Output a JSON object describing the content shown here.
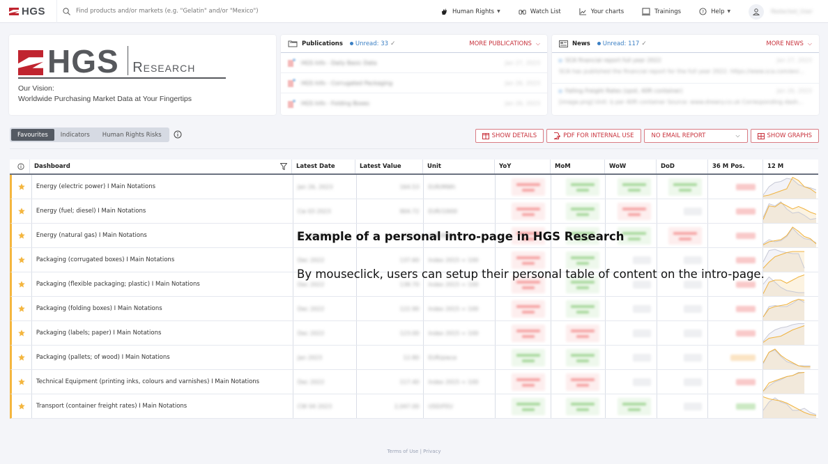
{
  "topbar": {
    "brand": "HGS",
    "search_placeholder": "Find products and/or markets (e.g. \"Gelatin\" and/or \"Mexico\")",
    "nav": [
      {
        "label": "Human Rights",
        "icon": "hand-icon",
        "dropdown": true
      },
      {
        "label": "Watch List",
        "icon": "binoculars-icon",
        "dropdown": false
      },
      {
        "label": "Your charts",
        "icon": "chart-icon",
        "dropdown": false
      },
      {
        "label": "Trainings",
        "icon": "monitor-icon",
        "dropdown": false
      },
      {
        "label": "Help",
        "icon": "help-icon",
        "dropdown": true
      }
    ],
    "user_name": "Redacted_User"
  },
  "logo_card": {
    "brand": "HGS",
    "research": "Research",
    "vision_line1": "Our Vision:",
    "vision_line2": "Worldwide Purchasing Market Data at Your Fingertips"
  },
  "publications": {
    "title": "Publications",
    "unread": "Unread: 33",
    "more": "MORE PUBLICATIONS",
    "items": [
      {
        "title": "HGS Info - Daily Basic Data",
        "date": "Jan 27, 2023"
      },
      {
        "title": "HGS Info - Corrugated Packaging",
        "date": "Jan 26, 2023"
      },
      {
        "title": "HGS Info - Folding Boxes",
        "date": "Jan 26, 2023"
      }
    ]
  },
  "news": {
    "title": "News",
    "unread": "Unread: 117",
    "more": "MORE NEWS",
    "items": [
      {
        "title": "SCA financial report full year 2022",
        "date": "Jan 27, 2023",
        "body": "SCA has published the financial report for the full year 2022. https://www.sca.com/en/..."
      },
      {
        "title": "Falling Freight Rates (spot, 40ft container)",
        "date": "Jan 26, 2023",
        "body": "[image.png] Unit: $ per 40ft container Source: www.drewry.co.uk Corresponding dash..."
      }
    ]
  },
  "tabs": [
    {
      "label": "Favourites",
      "active": true
    },
    {
      "label": "Indicators",
      "active": false
    },
    {
      "label": "Human Rights Risks",
      "active": false
    }
  ],
  "actions": {
    "show_details": "SHOW DETAILS",
    "pdf": "PDF FOR INTERNAL USE",
    "email_select": "NO EMAIL REPORT",
    "show_graphs": "SHOW GRAPHS"
  },
  "table": {
    "columns": [
      "Dashboard",
      "Latest Date",
      "Latest Value",
      "Unit",
      "YoY",
      "MoM",
      "WoW",
      "DoD",
      "36 M Pos.",
      "12 M"
    ],
    "rows": [
      {
        "name": "Energy (electric power) I Main Notations",
        "date": "Jan 26, 2023",
        "value": "164.53",
        "unit": "EUR/MWh",
        "yoy": "red",
        "mom": "green",
        "wow": "green",
        "dod": "green",
        "pos": "red"
      },
      {
        "name": "Energy (fuel; diesel) I Main Notations",
        "date": "Cw 03 2023",
        "value": "904.72",
        "unit": "EUR/1000l",
        "yoy": "red",
        "mom": "green",
        "wow": "red",
        "dod": "gray",
        "pos": "red"
      },
      {
        "name": "Energy (natural gas) I Main Notations",
        "date": "Jan 26, 2023",
        "value": "55.10",
        "unit": "EUR/MWh",
        "yoy": "red",
        "mom": "green",
        "wow": "green",
        "dod": "red",
        "pos": "red"
      },
      {
        "name": "Packaging (corrugated boxes) I Main Notations",
        "date": "Dec 2022",
        "value": "137.60",
        "unit": "Index 2015 = 100",
        "yoy": "red",
        "mom": "green",
        "wow": "gray",
        "dod": "gray",
        "pos": "red"
      },
      {
        "name": "Packaging (flexible packaging; plastic) I Main Notations",
        "date": "Dec 2022",
        "value": "138.70",
        "unit": "Index 2015 = 100",
        "yoy": "red",
        "mom": "green",
        "wow": "gray",
        "dod": "gray",
        "pos": "red"
      },
      {
        "name": "Packaging (folding boxes) I Main Notations",
        "date": "Dec 2022",
        "value": "122.90",
        "unit": "Index 2015 = 100",
        "yoy": "red",
        "mom": "green",
        "wow": "gray",
        "dod": "gray",
        "pos": "red"
      },
      {
        "name": "Packaging (labels; paper) I Main Notations",
        "date": "Dec 2022",
        "value": "123.00",
        "unit": "Index 2015 = 100",
        "yoy": "red",
        "mom": "red",
        "wow": "gray",
        "dod": "gray",
        "pos": "red"
      },
      {
        "name": "Packaging (pallets; of wood) I Main Notations",
        "date": "Jan 2023",
        "value": "12.80",
        "unit": "EUR/piece",
        "yoy": "green",
        "mom": "green",
        "wow": "gray",
        "dod": "gray",
        "pos": "orange"
      },
      {
        "name": "Technical Equipment (printing inks, colours and varnishes) I Main Notations",
        "date": "Dec 2022",
        "value": "117.40",
        "unit": "Index 2015 = 100",
        "yoy": "red",
        "mom": "red",
        "wow": "gray",
        "dod": "gray",
        "pos": "red"
      },
      {
        "name": "Transport (container freight rates) I Main Notations",
        "date": "CW 04 2023",
        "value": "2,047.00",
        "unit": "USD/FEU",
        "yoy": "green",
        "mom": "green",
        "wow": "green",
        "dod": "gray",
        "pos": "green"
      }
    ],
    "sparklines": [
      {
        "current": [
          0.05,
          0.1,
          0.2,
          0.3,
          0.4,
          0.95,
          0.8,
          0.5,
          0.4,
          0.2
        ],
        "previous": [
          0.1,
          0.5,
          0.7,
          0.75,
          0.9,
          0.85,
          0.6,
          0.5,
          0.45,
          0.35
        ]
      },
      {
        "current": [
          0.1,
          0.75,
          0.7,
          0.9,
          0.75,
          0.6,
          0.72,
          0.6,
          0.45,
          0.35
        ],
        "previous": [
          0.2,
          0.85,
          0.75,
          0.95,
          0.6,
          0.4,
          0.45,
          0.3,
          0.1,
          0.15
        ]
      },
      {
        "current": [
          0.05,
          0.2,
          0.25,
          0.3,
          0.5,
          0.9,
          0.7,
          0.45,
          0.35,
          0.1
        ],
        "previous": [
          0.1,
          0.3,
          0.2,
          0.25,
          0.45,
          0.85,
          0.55,
          0.35,
          0.3,
          0.15
        ]
      },
      {
        "current": [
          0.1,
          0.4,
          0.65,
          0.75,
          0.85,
          0.9,
          0.9,
          0.9,
          null,
          null
        ],
        "previous": [
          0.4,
          0.95,
          1.0,
          0.9,
          0.85,
          0.8,
          0.8,
          0.1,
          null,
          null
        ]
      },
      {
        "current": [
          0.05,
          0.6,
          0.7,
          0.7,
          0.55,
          0.7,
          0.85,
          0.95,
          null,
          null
        ],
        "previous": [
          0.5,
          0.85,
          0.6,
          0.35,
          0.2,
          0.15,
          0.1,
          0.1,
          null,
          null
        ]
      },
      {
        "current": [
          0.1,
          0.5,
          0.6,
          0.65,
          0.7,
          0.85,
          0.95,
          0.9,
          null,
          null
        ],
        "previous": [
          0.1,
          0.6,
          0.65,
          0.6,
          0.6,
          0.75,
          0.95,
          0.8,
          null,
          null
        ]
      },
      {
        "current": [
          0.05,
          0.25,
          0.3,
          0.35,
          0.5,
          0.65,
          0.75,
          0.85,
          null,
          null
        ],
        "previous": [
          0.1,
          0.45,
          0.65,
          0.75,
          0.8,
          0.9,
          0.95,
          0.95,
          null,
          null
        ]
      },
      {
        "current": [
          0.25,
          0.75,
          0.9,
          0.6,
          0.4,
          0.25,
          0.1,
          0.05,
          0.05,
          null
        ],
        "previous": [
          0.2,
          0.75,
          0.85,
          0.55,
          0.3,
          0.2,
          0.1,
          0.1,
          0.1,
          null
        ]
      },
      {
        "current": [
          0.05,
          0.45,
          0.55,
          0.65,
          0.75,
          0.8,
          0.92,
          0.95,
          null,
          null
        ],
        "previous": [
          0.05,
          0.3,
          0.5,
          0.6,
          0.75,
          0.8,
          0.95,
          0.95,
          null,
          null
        ]
      },
      {
        "current": [
          0.95,
          0.85,
          0.8,
          0.75,
          0.65,
          0.5,
          0.35,
          0.2,
          0.1,
          0.05
        ],
        "previous": [
          0.3,
          0.7,
          0.9,
          0.7,
          0.6,
          0.3,
          0.3,
          0.4,
          0.2,
          0.1
        ]
      }
    ]
  },
  "overlay": {
    "title": "Example of a personal intro-page in HGS Research",
    "subtitle": "By mouseclick, users can setup their personal table of content on the intro-page."
  },
  "footer": {
    "terms": "Terms of Use",
    "separator": "|",
    "privacy": "Privacy"
  },
  "colors": {
    "accent": "#c8323c",
    "star": "#f4b63f",
    "unread": "#3a7fc4",
    "spark_current": "#f0b340",
    "spark_previous": "#c7c9d6"
  }
}
